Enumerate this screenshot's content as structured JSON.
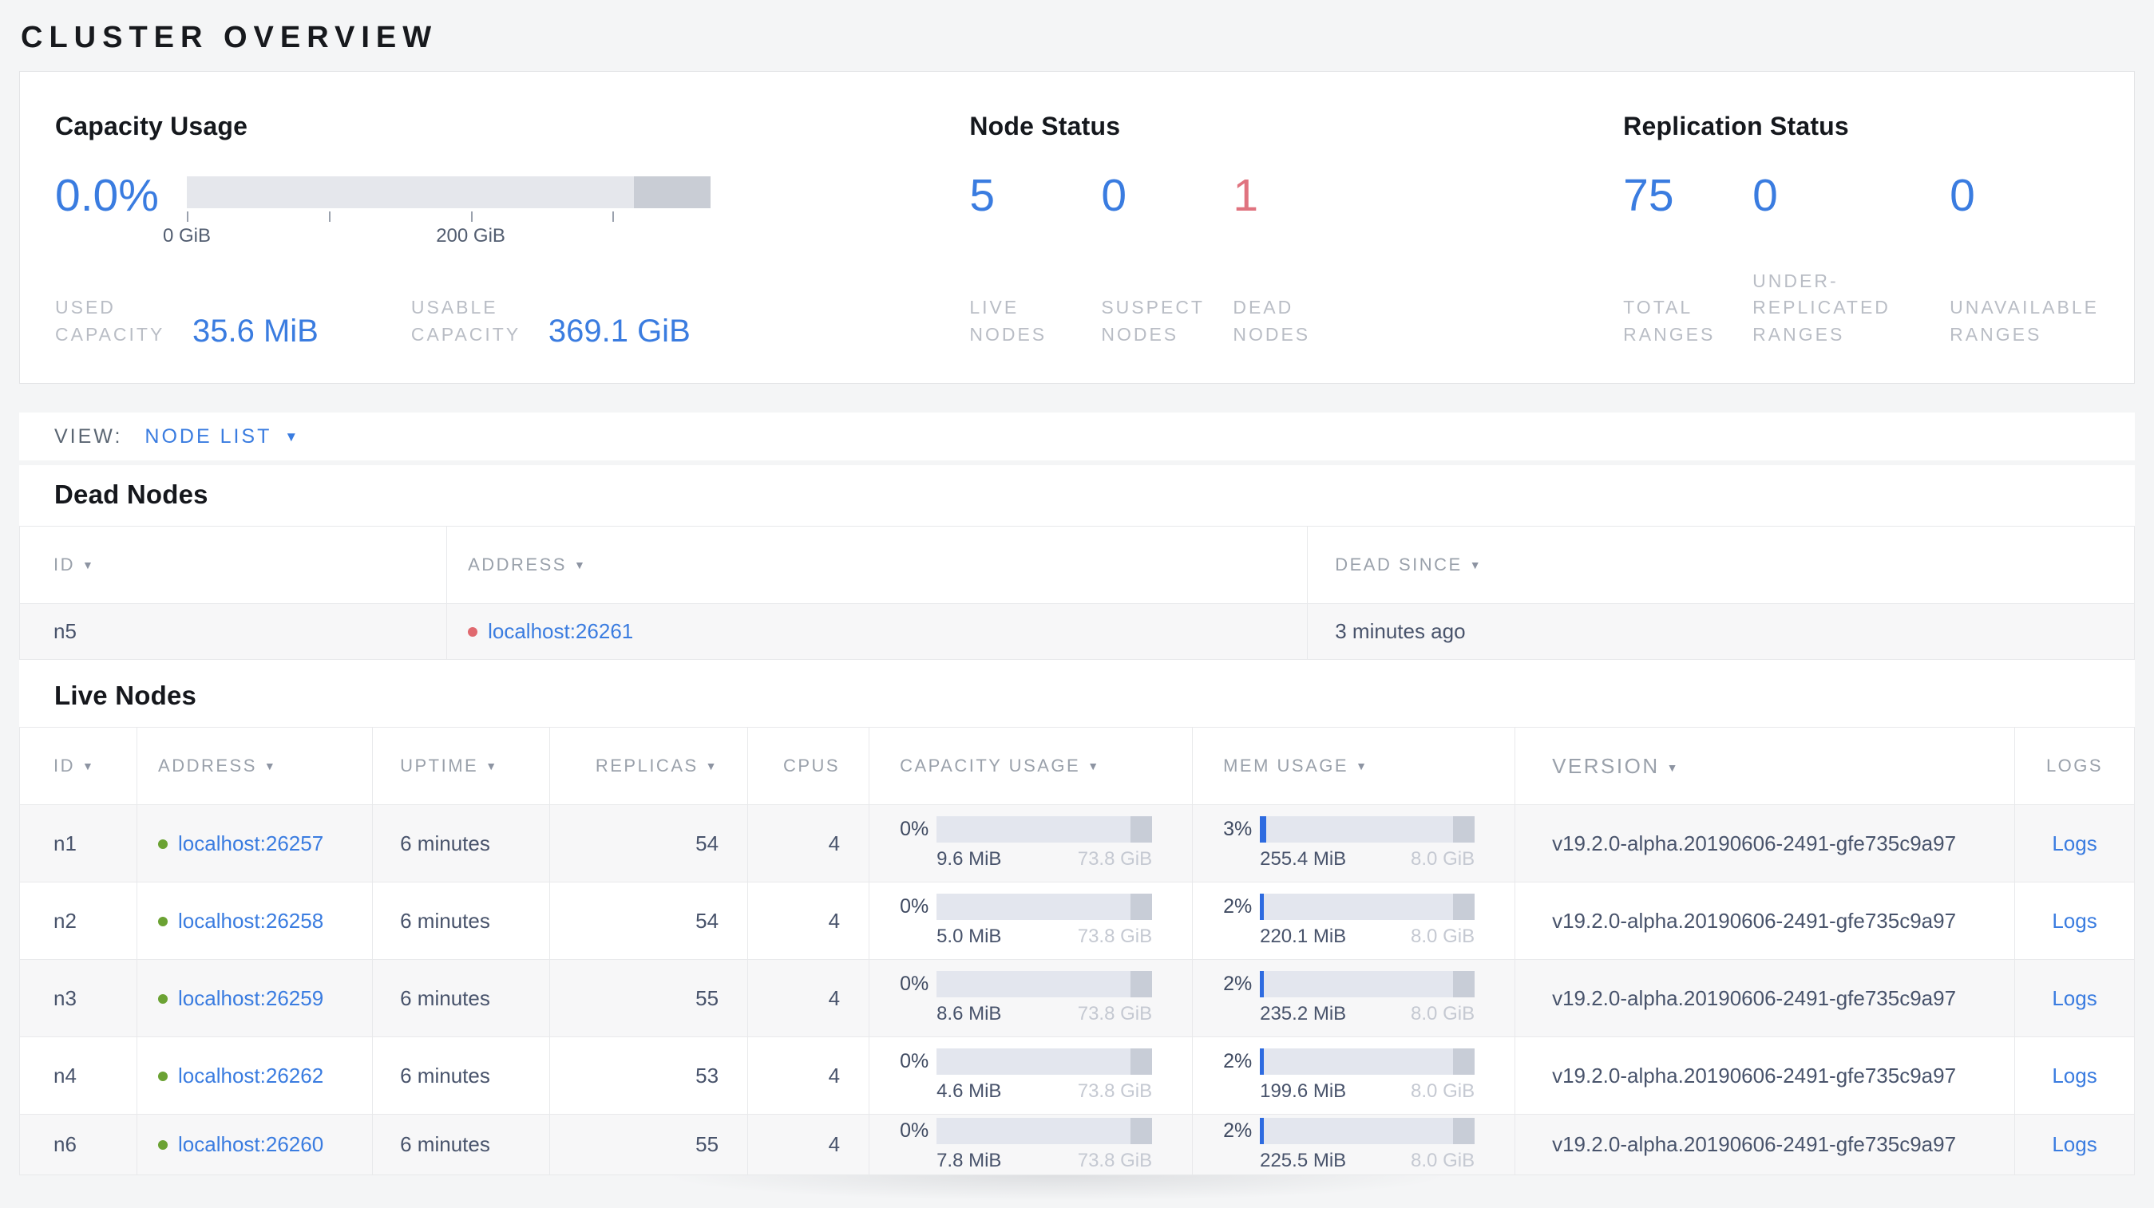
{
  "page_title": "CLUSTER OVERVIEW",
  "colors": {
    "accent_blue": "#3a7ce0",
    "dead_red": "#e0737f",
    "live_dot_green": "#6ba233",
    "dead_dot_red": "#e0696f",
    "bar_track": "#e3e6ee",
    "bar_used_blue": "#2e6be0",
    "bar_end_gray": "#c8cdd7"
  },
  "icons": {
    "sort_desc": "▼",
    "caret_down": "▼"
  },
  "summary": {
    "capacity": {
      "title": "Capacity Usage",
      "percent": "0.0%",
      "tick_labels": [
        "0 GiB",
        "200 GiB"
      ],
      "stats": [
        {
          "label": "USED CAPACITY",
          "value": "35.6 MiB"
        },
        {
          "label": "USABLE CAPACITY",
          "value": "369.1 GiB"
        }
      ]
    },
    "node_status": {
      "title": "Node Status",
      "stats": [
        {
          "value": "5",
          "label": "LIVE NODES",
          "tone": "blue"
        },
        {
          "value": "0",
          "label": "SUSPECT NODES",
          "tone": "blue"
        },
        {
          "value": "1",
          "label": "DEAD NODES",
          "tone": "red"
        }
      ]
    },
    "replication": {
      "title": "Replication Status",
      "stats": [
        {
          "value": "75",
          "label": "TOTAL RANGES",
          "tone": "blue"
        },
        {
          "value": "0",
          "label": "UNDER-REPLICATED RANGES",
          "tone": "blue"
        },
        {
          "value": "0",
          "label": "UNAVAILABLE RANGES",
          "tone": "blue"
        }
      ]
    }
  },
  "view_bar": {
    "label": "VIEW:",
    "selected": "NODE LIST"
  },
  "dead_nodes": {
    "title": "Dead Nodes",
    "columns": [
      {
        "label": "ID",
        "sortable": true
      },
      {
        "label": "ADDRESS",
        "sortable": true
      },
      {
        "label": "DEAD SINCE",
        "sortable": true
      }
    ],
    "rows": [
      {
        "id": "n5",
        "address": "localhost:26261",
        "dead_since": "3 minutes ago"
      }
    ]
  },
  "live_nodes": {
    "title": "Live Nodes",
    "columns": [
      {
        "label": "ID",
        "sortable": true
      },
      {
        "label": "ADDRESS",
        "sortable": true
      },
      {
        "label": "UPTIME",
        "sortable": true
      },
      {
        "label": "REPLICAS",
        "sortable": true
      },
      {
        "label": "CPUS",
        "sortable": false
      },
      {
        "label": "CAPACITY USAGE",
        "sortable": true
      },
      {
        "label": "MEM USAGE",
        "sortable": true
      },
      {
        "label": "VERSION",
        "sortable": true
      },
      {
        "label": "LOGS",
        "sortable": false
      }
    ],
    "logs_label": "Logs",
    "rows": [
      {
        "id": "n1",
        "address": "localhost:26257",
        "uptime": "6 minutes",
        "replicas": "54",
        "cpus": "4",
        "capacity": {
          "pct": "0%",
          "used_pct": "0%",
          "used": "9.6 MiB",
          "total": "73.8 GiB"
        },
        "mem": {
          "pct": "3%",
          "used_pct": "3%",
          "used": "255.4 MiB",
          "total": "8.0 GiB"
        },
        "version": "v19.2.0-alpha.20190606-2491-gfe735c9a97"
      },
      {
        "id": "n2",
        "address": "localhost:26258",
        "uptime": "6 minutes",
        "replicas": "54",
        "cpus": "4",
        "capacity": {
          "pct": "0%",
          "used_pct": "0%",
          "used": "5.0 MiB",
          "total": "73.8 GiB"
        },
        "mem": {
          "pct": "2%",
          "used_pct": "2%",
          "used": "220.1 MiB",
          "total": "8.0 GiB"
        },
        "version": "v19.2.0-alpha.20190606-2491-gfe735c9a97"
      },
      {
        "id": "n3",
        "address": "localhost:26259",
        "uptime": "6 minutes",
        "replicas": "55",
        "cpus": "4",
        "capacity": {
          "pct": "0%",
          "used_pct": "0%",
          "used": "8.6 MiB",
          "total": "73.8 GiB"
        },
        "mem": {
          "pct": "2%",
          "used_pct": "2%",
          "used": "235.2 MiB",
          "total": "8.0 GiB"
        },
        "version": "v19.2.0-alpha.20190606-2491-gfe735c9a97"
      },
      {
        "id": "n4",
        "address": "localhost:26262",
        "uptime": "6 minutes",
        "replicas": "53",
        "cpus": "4",
        "capacity": {
          "pct": "0%",
          "used_pct": "0%",
          "used": "4.6 MiB",
          "total": "73.8 GiB"
        },
        "mem": {
          "pct": "2%",
          "used_pct": "2%",
          "used": "199.6 MiB",
          "total": "8.0 GiB"
        },
        "version": "v19.2.0-alpha.20190606-2491-gfe735c9a97"
      },
      {
        "id": "n6",
        "address": "localhost:26260",
        "uptime": "6 minutes",
        "replicas": "55",
        "cpus": "4",
        "capacity": {
          "pct": "0%",
          "used_pct": "0%",
          "used": "7.8 MiB",
          "total": "73.8 GiB"
        },
        "mem": {
          "pct": "2%",
          "used_pct": "2%",
          "used": "225.5 MiB",
          "total": "8.0 GiB"
        },
        "version": "v19.2.0-alpha.20190606-2491-gfe735c9a97"
      }
    ]
  },
  "gauge": {
    "usable_fraction_of_axis": 0.854,
    "axis_ticks_gib": [
      0,
      100,
      200,
      300
    ]
  }
}
